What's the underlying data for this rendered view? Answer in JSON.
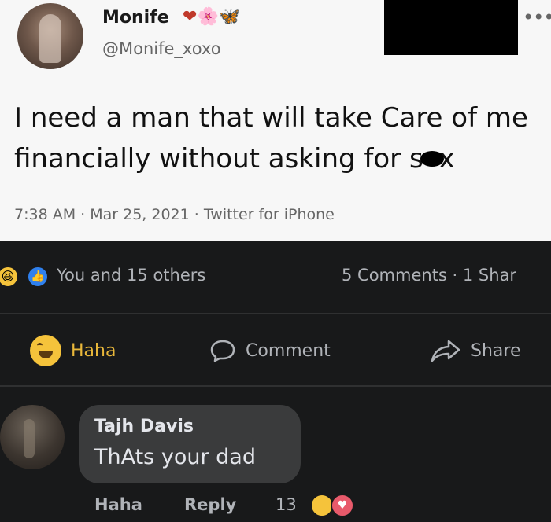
{
  "tweet": {
    "name": "Monife",
    "emojis": {
      "heart": "❤",
      "flower": "🌸",
      "butterfly": "🦋"
    },
    "handle": "@Monife_xoxo",
    "text_before": "I need a man that will take Care of me financially without asking for s",
    "text_after": "x",
    "meta": "7:38 AM · Mar 25, 2021 · Twitter for iPhone",
    "more_icon": "more-dots-icon"
  },
  "facebook": {
    "reactions_summary": "You and 15 others",
    "comments_shares": "5 Comments · 1 Shar",
    "actions": {
      "haha": "Haha",
      "comment": "Comment",
      "share": "Share"
    },
    "comment": {
      "author": "Tajh Davis",
      "text": "ThAts your dad",
      "haha": "Haha",
      "reply": "Reply",
      "reaction_count": "13"
    }
  },
  "colors": {
    "fb_bg": "#18191a",
    "bubble": "#3a3b3c",
    "haha_yellow": "#f5c33b",
    "tweet_bg": "#f7f7f7"
  }
}
